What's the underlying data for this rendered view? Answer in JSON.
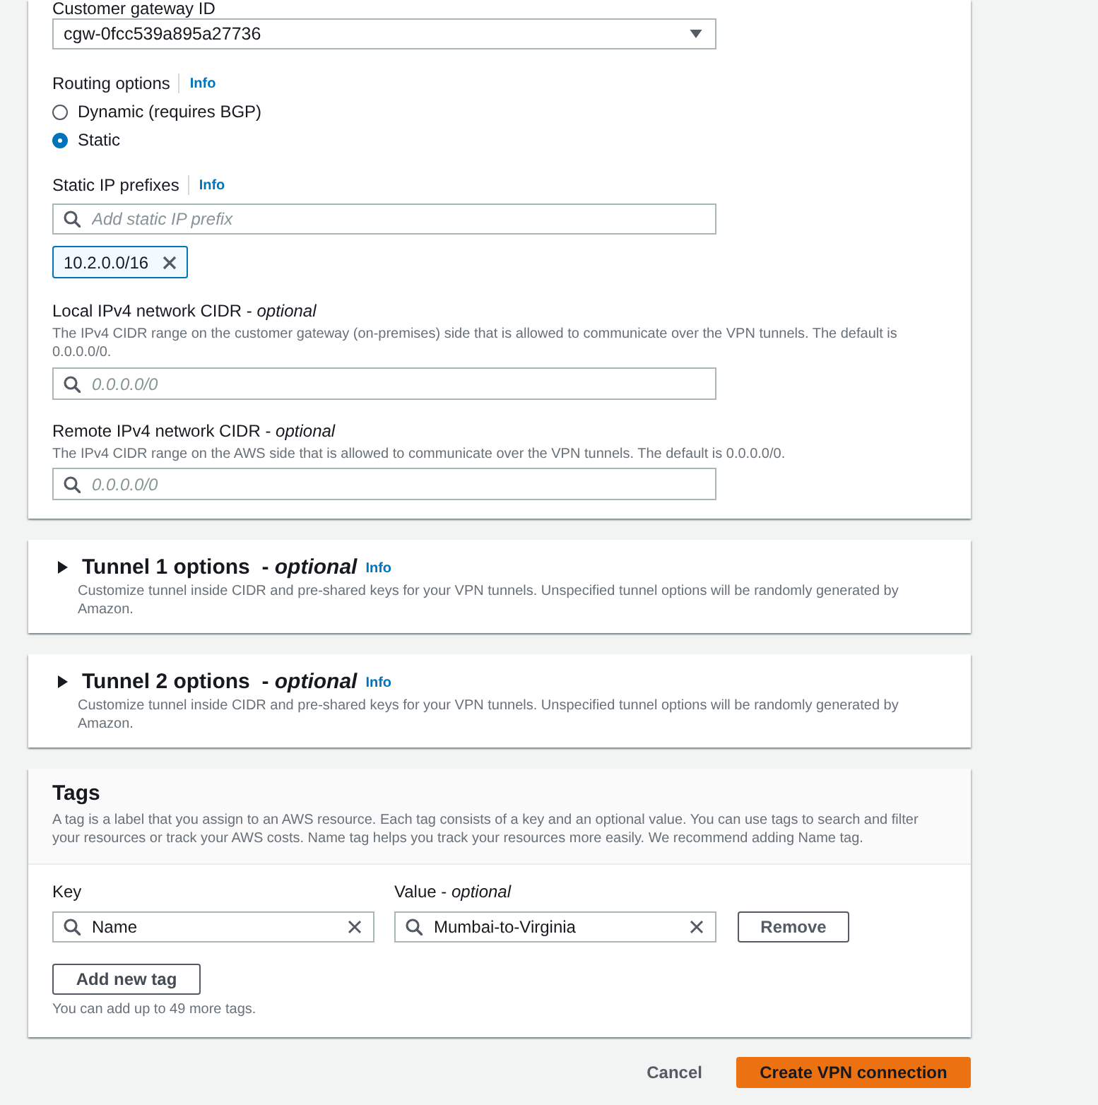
{
  "customer_gateway": {
    "label": "Customer gateway ID",
    "value": "cgw-0fcc539a895a27736"
  },
  "routing": {
    "label": "Routing options",
    "info": "Info",
    "options": [
      {
        "label": "Dynamic (requires BGP)",
        "selected": false
      },
      {
        "label": "Static",
        "selected": true
      }
    ]
  },
  "static_ip_prefixes": {
    "label": "Static IP prefixes",
    "info": "Info",
    "placeholder": "Add static IP prefix",
    "tokens": [
      "10.2.0.0/16"
    ]
  },
  "cidr_fields": [
    {
      "label": "Local IPv4 network CIDR - *optional*",
      "description": "The IPv4 CIDR range on the customer gateway (on-premises) side that is allowed to communicate over the VPN tunnels. The default is 0.0.0.0/0.",
      "placeholder": "0.0.0.0/0"
    },
    {
      "label": "Remote IPv4 network CIDR - *optional*",
      "description": "The IPv4 CIDR range on the AWS side that is allowed to communicate over the VPN tunnels. The default is 0.0.0.0/0.",
      "placeholder": "0.0.0.0/0"
    }
  ],
  "tunnels": [
    {
      "title": "Tunnel 1 options  - *optional*",
      "info": "Info",
      "description": "Customize tunnel inside CIDR and pre-shared keys for your VPN tunnels. Unspecified tunnel options will be randomly generated by Amazon.",
      "expanded": false
    },
    {
      "title": "Tunnel 2 options  - *optional*",
      "info": "Info",
      "description": "Customize tunnel inside CIDR and pre-shared keys for your VPN tunnels. Unspecified tunnel options will be randomly generated by Amazon.",
      "expanded": false
    }
  ],
  "tags": {
    "title": "Tags",
    "description": "A tag is a label that you assign to an AWS resource. Each tag consists of a key and an optional value. You can use tags to search and filter your resources or track your AWS costs. Name tag helps you track your resources more easily. We recommend adding Name tag.",
    "key_label": "Key",
    "value_label": "Value - *optional*",
    "rows": [
      {
        "key": "Name",
        "value": "Mumbai-to-Virginia",
        "remove": "Remove"
      }
    ],
    "add_button": "Add new tag",
    "limit_note": "You can add up to 49 more tags."
  },
  "footer": {
    "cancel": "Cancel",
    "submit": "Create VPN connection"
  }
}
